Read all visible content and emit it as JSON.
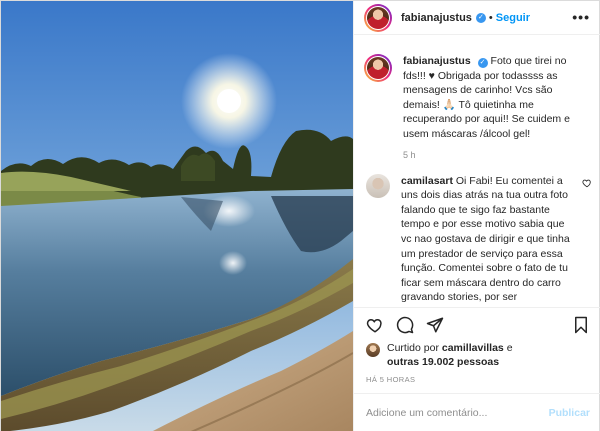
{
  "header": {
    "username": "fabianajustus",
    "separator": "•",
    "follow_label": "Seguir",
    "more_label": "•••"
  },
  "caption": {
    "username": "fabianajustus",
    "text": "Foto que tirei no fds!!! ♥ Obrigada por todassss as mensagens de carinho! Vcs são demais! 🙏🏻 Tô quietinha me recuperando por aqui!! Se cuidem e usem máscaras /álcool gel!",
    "time": "5 h"
  },
  "comment": {
    "username": "camilasart",
    "text": "Oi Fabi! Eu comentei a uns dois dias atrás na tua outra foto falando que te sigo faz bastante tempo e por esse motivo sabia que vc nao gostava de dirigir e que tinha um prestador de serviço para essa função. Comentei sobre o fato de tu ficar sem máscara dentro do carro gravando stories, por ser"
  },
  "likes": {
    "prefix": "Curtido por",
    "liker": "camillavillas",
    "and": "e",
    "others": "outras 19.002 pessoas"
  },
  "post_age": "HÁ 5 HORAS",
  "add_comment": {
    "placeholder": "Adicione um comentário...",
    "publish_label": "Publicar"
  },
  "colors": {
    "accent": "#0095f6",
    "publish_disabled": "#b2dffc",
    "muted": "#8e8e8e",
    "text": "#262626",
    "border": "#dbdbdb"
  },
  "icons": [
    "verified-badge-icon",
    "more-options-icon",
    "heart-icon",
    "comment-icon",
    "share-icon",
    "bookmark-icon",
    "small-heart-icon"
  ]
}
